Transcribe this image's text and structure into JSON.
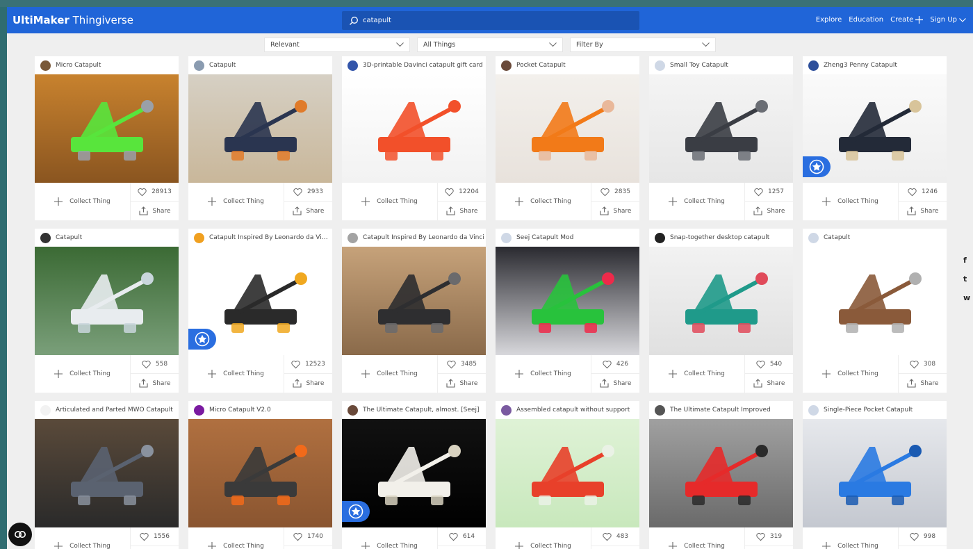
{
  "header": {
    "brand_bold": "UltiMaker",
    "brand_light": "Thingiverse",
    "search_value": "catapult",
    "nav": [
      "Explore",
      "Education",
      "Create",
      "Sign Up"
    ]
  },
  "filters": [
    "Relevant",
    "All Things",
    "Filter By"
  ],
  "labels": {
    "collect": "Collect Thing",
    "share": "Share"
  },
  "social": [
    "f",
    "t",
    "w"
  ],
  "cards": [
    {
      "title": "Micro Catapult",
      "likes": "28913",
      "avatar": "#7a5a3a",
      "featured": false,
      "bg": [
        "#c8822e",
        "#8a5520"
      ],
      "obj": "#58e53c",
      "obj2": "#9aa0a8"
    },
    {
      "title": "Catapult",
      "likes": "2933",
      "avatar": "#8a9bb0",
      "featured": false,
      "bg": [
        "#d6d0c4",
        "#c9b79a"
      ],
      "obj": "#2a3550",
      "obj2": "#e07b2a"
    },
    {
      "title": "3D-printable Davinci catapult gift card",
      "likes": "12204",
      "avatar": "#3355aa",
      "featured": false,
      "bg": [
        "#ffffff",
        "#f2f2f2"
      ],
      "obj": "#f2502a",
      "obj2": "#f2502a"
    },
    {
      "title": "Pocket Catapult",
      "likes": "2835",
      "avatar": "#6a4a3a",
      "featured": false,
      "bg": [
        "#f3f0ec",
        "#e8e2dc"
      ],
      "obj": "#f27a18",
      "obj2": "#e9b89a"
    },
    {
      "title": "Small Toy Catapult",
      "likes": "1257",
      "avatar": "#cfd8e6",
      "featured": false,
      "bg": [
        "#f4f4f4",
        "#e6e6e6"
      ],
      "obj": "#3a3d44",
      "obj2": "#6a6d74"
    },
    {
      "title": "Zheng3 Penny Catapult",
      "likes": "1246",
      "avatar": "#2d4f9a",
      "featured": true,
      "bg": [
        "#fafafa",
        "#eeeeee"
      ],
      "obj": "#232a38",
      "obj2": "#d8c49a"
    },
    {
      "title": "Catapult",
      "likes": "558",
      "avatar": "#333333",
      "featured": false,
      "bg": [
        "#3b6a34",
        "#7a9f7a"
      ],
      "obj": "#e8ecef",
      "obj2": "#c9d6dc"
    },
    {
      "title": "Catapult Inspired By Leonardo da Vinci (r...",
      "likes": "12523",
      "avatar": "#f0a020",
      "featured": true,
      "bg": [
        "#ffffff",
        "#ffffff"
      ],
      "obj": "#2a2a2a",
      "obj2": "#f0a820"
    },
    {
      "title": "Catapult Inspired By Leonardo da Vinci",
      "likes": "3485",
      "avatar": "#a3a3a3",
      "featured": false,
      "bg": [
        "#c6a27a",
        "#8a6a4a"
      ],
      "obj": "#2e2e30",
      "obj2": "#6a6a6c"
    },
    {
      "title": "Seej Catapult Mod",
      "likes": "426",
      "avatar": "#cfd8e6",
      "featured": false,
      "bg": [
        "#2a2a30",
        "#d8d8dc"
      ],
      "obj": "#28c23c",
      "obj2": "#ee2a4a"
    },
    {
      "title": "Snap-together desktop catapult",
      "likes": "540",
      "avatar": "#222222",
      "featured": false,
      "bg": [
        "#f2f2f2",
        "#e0e0e0"
      ],
      "obj": "#1f9a8a",
      "obj2": "#e04a5a"
    },
    {
      "title": "Catapult",
      "likes": "308",
      "avatar": "#cfd8e6",
      "featured": false,
      "bg": [
        "#ffffff",
        "#ffffff"
      ],
      "obj": "#8a5a3a",
      "obj2": "#b0b0b0"
    },
    {
      "title": "Articulated and Parted MWO Catapult",
      "likes": "1556",
      "avatar": "#f2f2f2",
      "featured": false,
      "bg": [
        "#5a4a3a",
        "#2a2a2a"
      ],
      "obj": "#5a6270",
      "obj2": "#8a929e"
    },
    {
      "title": "Micro Catapult V2.0",
      "likes": "1740",
      "avatar": "#7a1aa0",
      "featured": false,
      "bg": [
        "#b07040",
        "#8a5530"
      ],
      "obj": "#3a3a3a",
      "obj2": "#f26a1a"
    },
    {
      "title": "The Ultimate Catapult, almost. [Seej]",
      "likes": "614",
      "avatar": "#6a4a3a",
      "featured": true,
      "bg": [
        "#111111",
        "#000000"
      ],
      "obj": "#f2f0ea",
      "obj2": "#d8d2c0"
    },
    {
      "title": "Assembled catapult without support",
      "likes": "483",
      "avatar": "#7a5aa0",
      "featured": false,
      "bg": [
        "#dff2d6",
        "#c8e8bc"
      ],
      "obj": "#e8402a",
      "obj2": "#eaf2e6"
    },
    {
      "title": "The Ultimate Catapult Improved",
      "likes": "319",
      "avatar": "#555555",
      "featured": false,
      "bg": [
        "#a0a0a0",
        "#6a6a6a"
      ],
      "obj": "#e62a2a",
      "obj2": "#2a2a2a"
    },
    {
      "title": "Single-Piece Pocket Catapult",
      "likes": "998",
      "avatar": "#cfd8e6",
      "featured": false,
      "bg": [
        "#e6e8ec",
        "#c4c8d0"
      ],
      "obj": "#2a7ae2",
      "obj2": "#1a5ab2"
    }
  ]
}
